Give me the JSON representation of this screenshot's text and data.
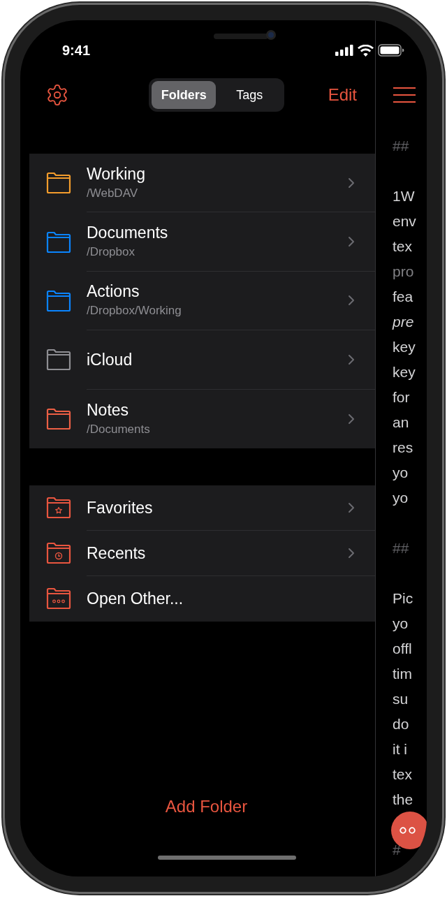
{
  "status_bar": {
    "time": "9:41"
  },
  "header": {
    "tabs": [
      {
        "label": "Folders",
        "selected": true
      },
      {
        "label": "Tags",
        "selected": false
      }
    ],
    "edit": "Edit"
  },
  "locations": [
    {
      "name": "Working",
      "path": "/WebDAV",
      "color": "#f39c2c",
      "chevron": true
    },
    {
      "name": "Documents",
      "path": "/Dropbox",
      "color": "#0a84ff",
      "chevron": true
    },
    {
      "name": "Actions",
      "path": "/Dropbox/Working",
      "color": "#0a84ff",
      "chevron": true
    },
    {
      "name": "iCloud",
      "color": "#8e8e93",
      "chevron": true
    },
    {
      "name": "Notes",
      "path": "/Documents",
      "color": "#ec5f45",
      "chevron": true
    }
  ],
  "shortcuts": [
    {
      "kind": "star",
      "label": "Favorites",
      "chevron": true
    },
    {
      "kind": "clock",
      "label": "Recents",
      "chevron": true
    },
    {
      "kind": "dots",
      "label": "Open Other...",
      "chevron": false
    }
  ],
  "add_folder": "Add Folder",
  "editor": {
    "lines": [
      {
        "kind": "heading",
        "text": "##"
      },
      {
        "kind": "text",
        "text": "1W"
      },
      {
        "kind": "text",
        "text": "env"
      },
      {
        "kind": "text",
        "text": "tex"
      },
      {
        "kind": "dim",
        "text": "pro"
      },
      {
        "kind": "text",
        "text": "fea"
      },
      {
        "kind": "italic",
        "text": "pre"
      },
      {
        "kind": "text",
        "text": "key"
      },
      {
        "kind": "text",
        "text": "key"
      },
      {
        "kind": "text",
        "text": "for"
      },
      {
        "kind": "text",
        "text": "an"
      },
      {
        "kind": "text",
        "text": "res"
      },
      {
        "kind": "text",
        "text": "yo"
      },
      {
        "kind": "text",
        "text": "yo"
      },
      {
        "kind": "heading",
        "text": "##"
      },
      {
        "kind": "text",
        "text": "Pic"
      },
      {
        "kind": "text",
        "text": "yo"
      },
      {
        "kind": "text",
        "text": "offl"
      },
      {
        "kind": "text",
        "text": "tim"
      },
      {
        "kind": "text",
        "text": "su"
      },
      {
        "kind": "text",
        "text": "do"
      },
      {
        "kind": "text",
        "text": "it i"
      },
      {
        "kind": "text",
        "text": "tex"
      },
      {
        "kind": "text",
        "text": "the"
      },
      {
        "kind": "heading",
        "text": "#"
      }
    ]
  }
}
